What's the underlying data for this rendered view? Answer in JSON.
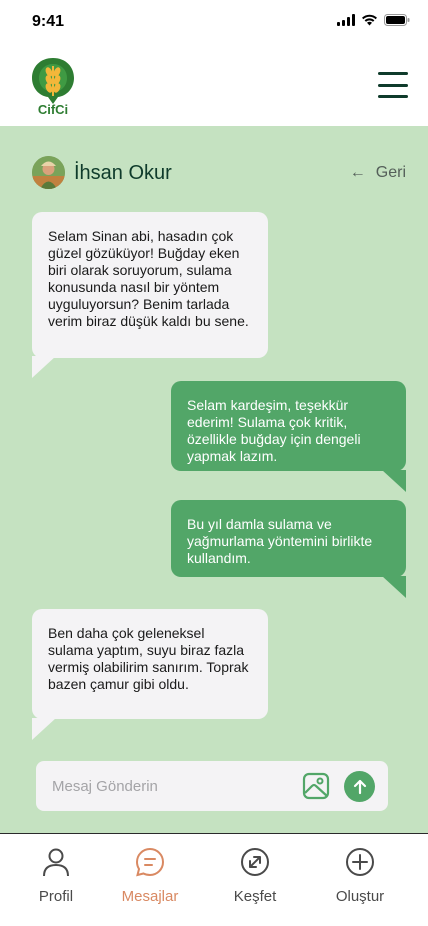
{
  "status_bar": {
    "time": "9:41"
  },
  "header": {
    "logo_text": "CifCi",
    "menu_icon": "hamburger-menu-icon"
  },
  "chat": {
    "contact_name": "İhsan Okur",
    "back_label": "Geri",
    "messages": [
      {
        "from": "incoming",
        "text": "Selam Sinan abi, hasadın çok güzel gözüküyor! Buğday eken biri olarak soruyorum, sulama konusunda nasıl bir yöntem uyguluyorsun? Benim tarlada verim biraz düşük kaldı bu sene."
      },
      {
        "from": "outgoing",
        "text": "Selam kardeşim, teşekkür ederim! Sulama çok kritik, özellikle buğday için dengeli yapmak lazım."
      },
      {
        "from": "outgoing",
        "text": "Bu yıl damla sulama ve yağmurlama yöntemini birlikte kullandım."
      },
      {
        "from": "incoming",
        "text": "Ben daha çok geleneksel sulama yaptım, suyu biraz fazla vermiş olabilirim sanırım. Toprak bazen çamur gibi oldu."
      }
    ],
    "input_placeholder": "Mesaj Gönderin"
  },
  "nav": {
    "items": [
      {
        "label": "Profil",
        "icon": "user-icon",
        "active": false
      },
      {
        "label": "Mesajlar",
        "icon": "chat-icon",
        "active": true
      },
      {
        "label": "Keşfet",
        "icon": "explore-icon",
        "active": false
      },
      {
        "label": "Oluştur",
        "icon": "plus-circle-icon",
        "active": false
      }
    ]
  },
  "colors": {
    "chat_background": "#c5e2c1",
    "outgoing_bubble": "#52a668",
    "incoming_bubble": "#f4f3f5",
    "active_nav": "#d98962",
    "brand_dark": "#0f3b2b"
  }
}
